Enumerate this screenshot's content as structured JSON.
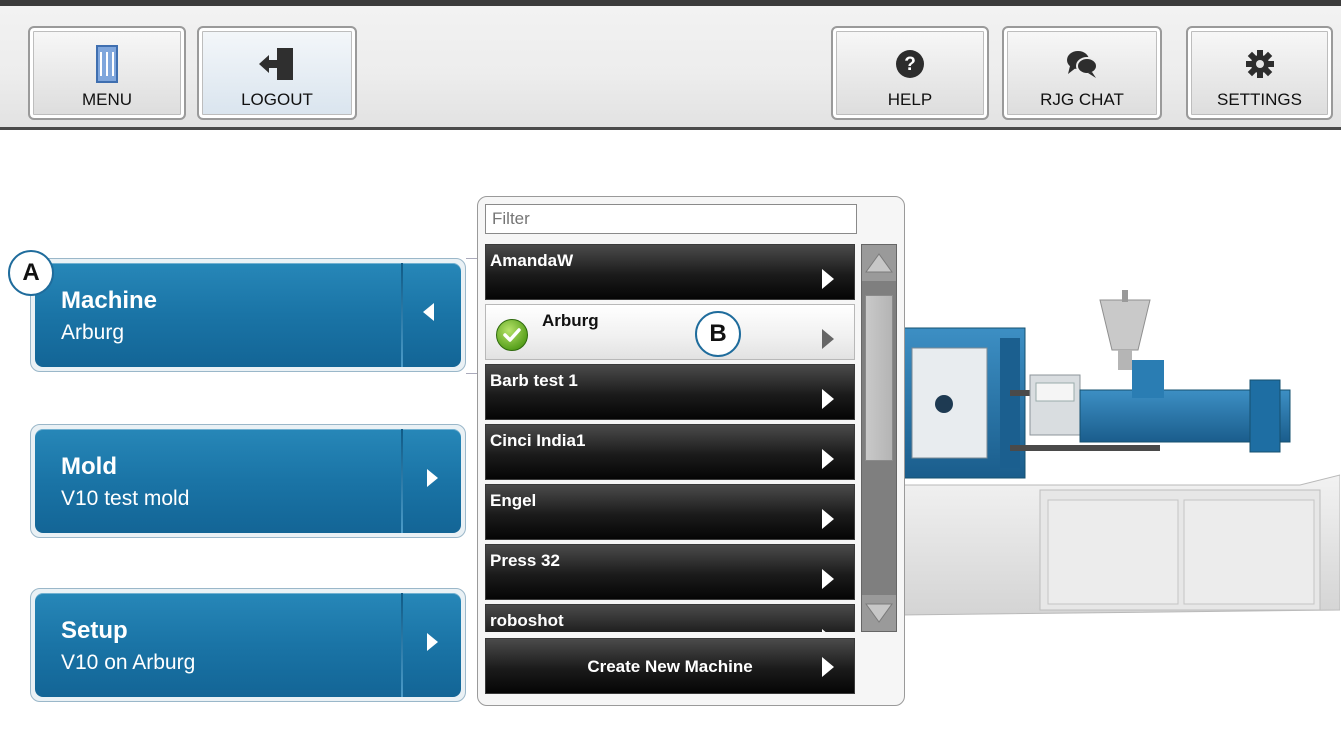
{
  "toolbar": {
    "menu_label": "MENU",
    "logout_label": "LOGOUT",
    "help_label": "HELP",
    "chat_label": "RJG CHAT",
    "settings_label": "SETTINGS"
  },
  "nav": {
    "machine": {
      "title": "Machine",
      "value": "Arburg"
    },
    "mold": {
      "title": "Mold",
      "value": "V10 test mold"
    },
    "setup": {
      "title": "Setup",
      "value": "V10 on Arburg"
    }
  },
  "callouts": {
    "a": "A",
    "b": "B"
  },
  "picker": {
    "filter_placeholder": "Filter",
    "machines": [
      {
        "name": "AmandaW"
      },
      {
        "name": "Arburg",
        "selected": true
      },
      {
        "name": "Barb test 1"
      },
      {
        "name": "Cinci India1"
      },
      {
        "name": "Engel"
      },
      {
        "name": "Press 32"
      },
      {
        "name": "roboshot"
      }
    ],
    "create_label": "Create New Machine"
  },
  "colors": {
    "nav_blue": "#1a74a6",
    "list_row": "#1b1b1b",
    "selected_check": "#5aa21e",
    "toolbar_top": "#3b3b3b"
  },
  "icons": {
    "menu": "rjg-logo-icon",
    "logout": "logout-door-icon",
    "help": "question-icon",
    "chat": "chat-bubbles-icon",
    "settings": "gear-icon"
  }
}
